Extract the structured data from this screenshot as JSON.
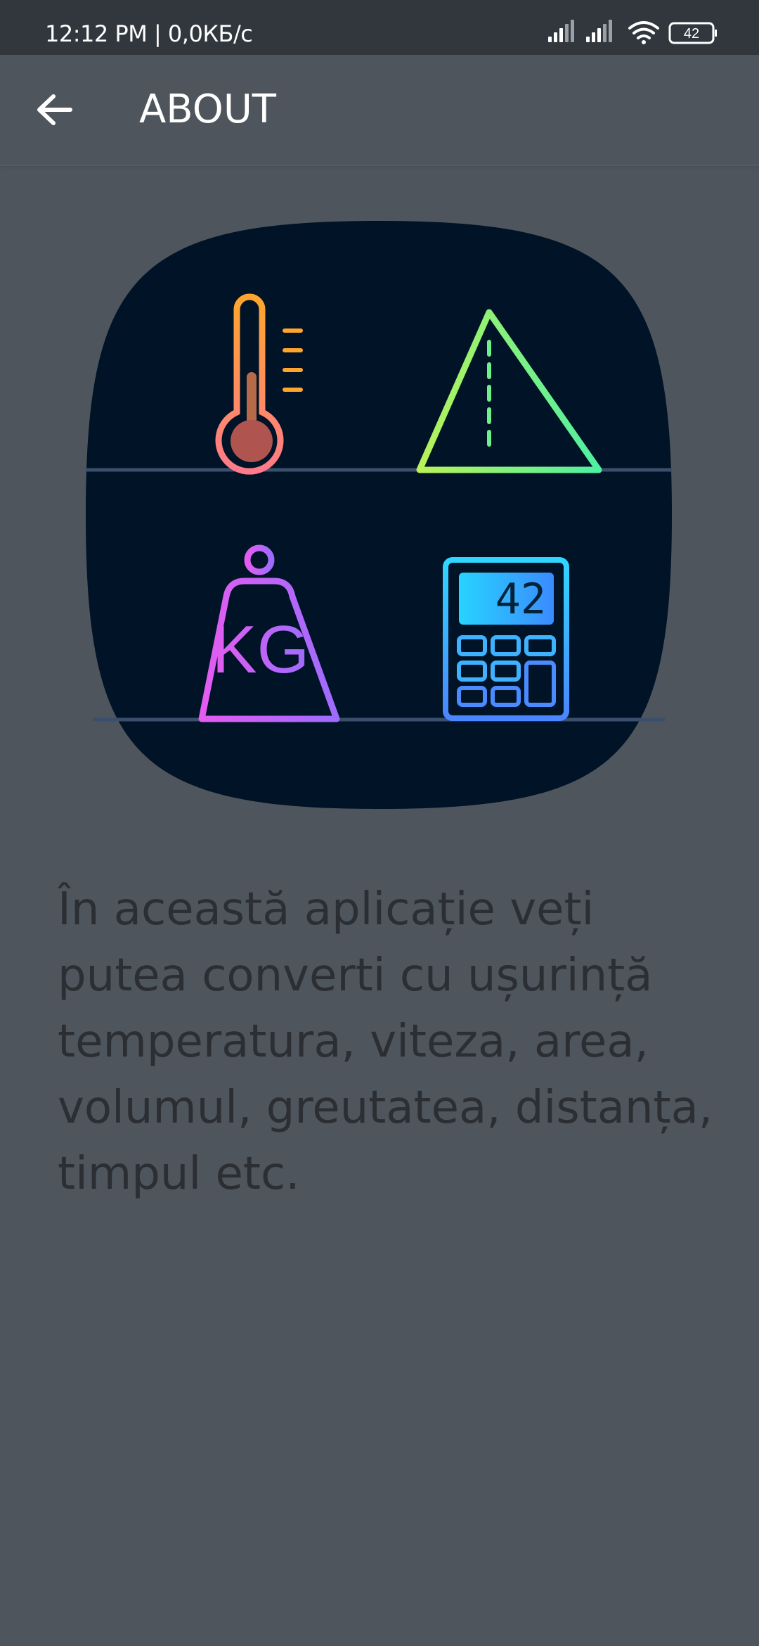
{
  "status_bar": {
    "time": "12:12 PM | 0,0КБ/с",
    "battery_level": "42",
    "icons": [
      "signal-icon",
      "signal-icon",
      "wifi-icon",
      "battery-icon"
    ]
  },
  "app_bar": {
    "title": "ABOUT",
    "back_icon": "arrow-left-icon"
  },
  "logo": {
    "calculator_display": "42",
    "weight_label": "KG",
    "icons": [
      "thermometer-icon",
      "triangle-icon",
      "weight-icon",
      "calculator-icon"
    ],
    "colors": {
      "background": "#011326",
      "shelf": "#3a4f6b",
      "thermometer": "#ff9a3a",
      "triangle": "#8ef26e",
      "weight": "#c65cff",
      "calculator": "#36b7ff"
    }
  },
  "content": {
    "description": "În această aplicație veți putea converti cu ușurință temperatura, viteza, area, volumul, greutatea, distanța, timpul etc."
  },
  "colors": {
    "background": "#4f555d",
    "status_bar": "#32373d",
    "text": "#2b2f34"
  }
}
